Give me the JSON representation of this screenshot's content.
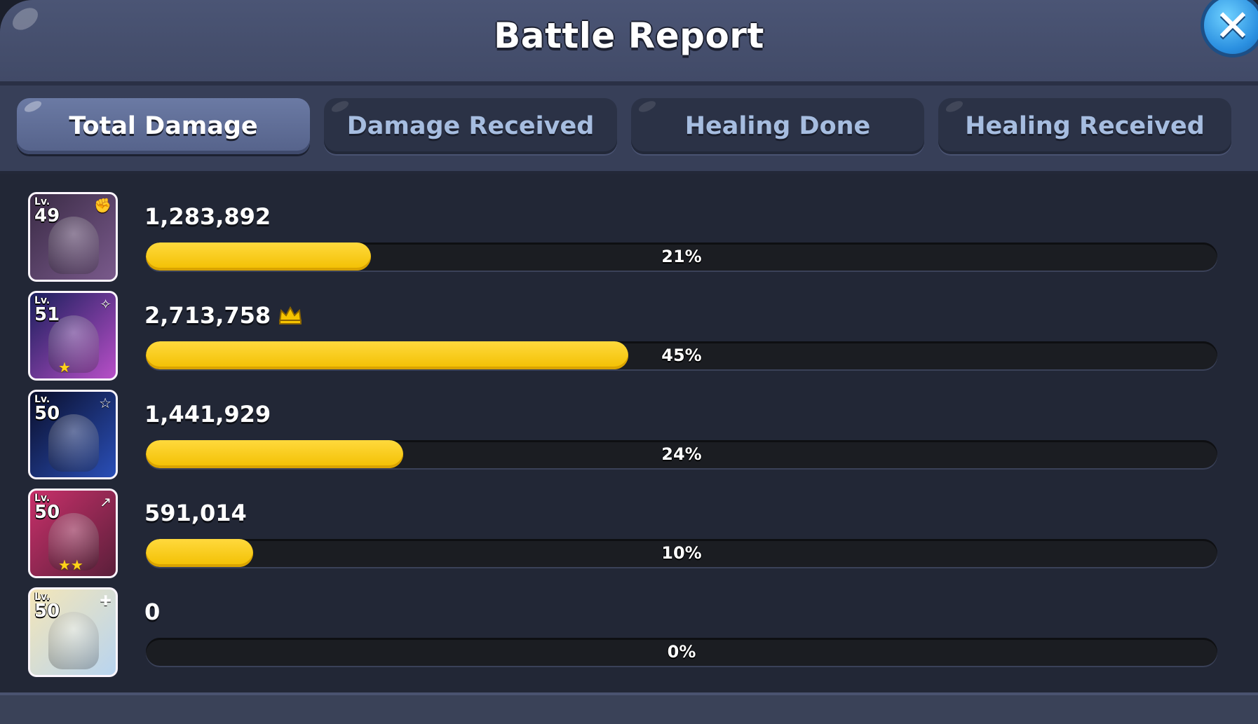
{
  "window": {
    "title": "Battle Report",
    "close_symbol": "✕"
  },
  "tabs": [
    {
      "label": "Total Damage",
      "active": true
    },
    {
      "label": "Damage Received",
      "active": false
    },
    {
      "label": "Healing Done",
      "active": false
    },
    {
      "label": "Healing Received",
      "active": false
    }
  ],
  "rows": [
    {
      "lv_label": "Lv.",
      "level": "49",
      "class_icon": "fist-icon",
      "stars": "",
      "value": "1,283,892",
      "percent_label": "21%",
      "percent": 0.21,
      "top": false,
      "portrait_colors": [
        "#3a2b45",
        "#7a5a8c"
      ]
    },
    {
      "lv_label": "Lv.",
      "level": "51",
      "class_icon": "magic-icon",
      "stars": "★",
      "value": "2,713,758",
      "percent_label": "45%",
      "percent": 0.45,
      "top": true,
      "portrait_colors": [
        "#1a1f5c",
        "#b84fc8"
      ]
    },
    {
      "lv_label": "Lv.",
      "level": "50",
      "class_icon": "star-icon",
      "stars": "",
      "value": "1,441,929",
      "percent_label": "24%",
      "percent": 0.24,
      "top": false,
      "portrait_colors": [
        "#0a0e2a",
        "#2a4fb8"
      ]
    },
    {
      "lv_label": "Lv.",
      "level": "50",
      "class_icon": "dagger-icon",
      "stars": "★★",
      "value": "591,014",
      "percent_label": "10%",
      "percent": 0.1,
      "top": false,
      "portrait_colors": [
        "#c8306a",
        "#5a1f3a"
      ]
    },
    {
      "lv_label": "Lv.",
      "level": "50",
      "class_icon": "plus-icon",
      "stars": "",
      "value": "0",
      "percent_label": "0%",
      "percent": 0.0,
      "top": false,
      "portrait_colors": [
        "#f4e6b8",
        "#b8d4f0"
      ]
    }
  ],
  "colors": {
    "accent_yellow": "#f5c400",
    "crown": "#f5c400"
  }
}
